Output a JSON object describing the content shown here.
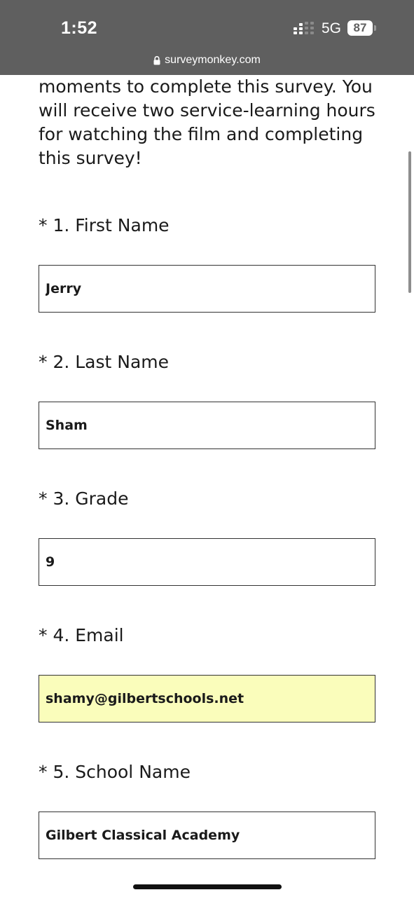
{
  "status_bar": {
    "time": "1:52",
    "network": "5G",
    "battery": "87",
    "url": "surveymonkey.com"
  },
  "intro": {
    "text": "moments to complete this survey. You will receive two service-learning hours for watching the film and completing this survey!"
  },
  "questions": [
    {
      "label": "* 1. First Name",
      "value": "Jerry"
    },
    {
      "label": "* 2. Last Name",
      "value": "Sham"
    },
    {
      "label": "* 3. Grade",
      "value": "9"
    },
    {
      "label": "* 4. Email",
      "value": "shamy@gilbertschools.net"
    },
    {
      "label": "* 5. School Name",
      "value": "Gilbert Classical Academy"
    }
  ],
  "colors": {
    "status_bar_bg": "#5f5f5f",
    "autofill_bg": "#fafdbb",
    "field_border": "#333333"
  }
}
